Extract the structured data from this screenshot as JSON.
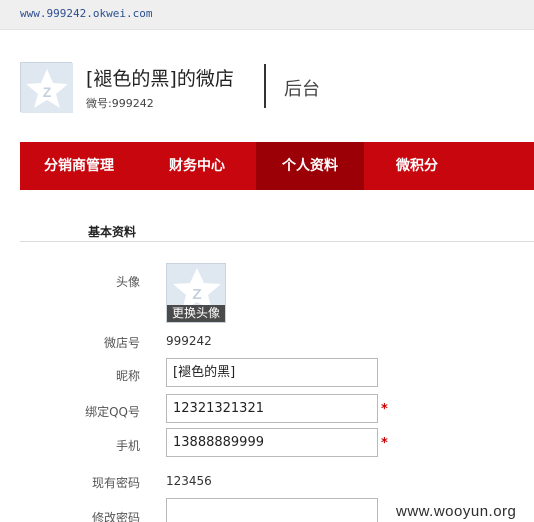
{
  "browser": {
    "url": "www.999242.okwei.com"
  },
  "header": {
    "store_title": "[褪色的黑]的微店",
    "store_id": "微号:999242",
    "backend_label": "后台"
  },
  "nav": {
    "items": [
      {
        "label": "分销商管理"
      },
      {
        "label": "财务中心"
      },
      {
        "label": "个人资料"
      },
      {
        "label": "微积分"
      }
    ],
    "active_index": 2,
    "colors": {
      "bar": "#c8060e",
      "active": "#9a0006"
    }
  },
  "profile": {
    "section_title": "基本资料",
    "avatar_label": "头像",
    "change_avatar_button": "更换头像",
    "store_no_label": "微店号",
    "store_no_value": "999242",
    "nickname_label": "昵称",
    "nickname_value": "[褪色的黑]",
    "qq_label": "绑定QQ号",
    "qq_value": "12321321321",
    "phone_label": "手机",
    "phone_value": "13888889999",
    "required_mark": "*",
    "current_password_label": "现有密码",
    "current_password_value": "123456",
    "change_password_label": "修改密码",
    "change_password_value": ""
  },
  "watermark": "www.wooyun.org"
}
